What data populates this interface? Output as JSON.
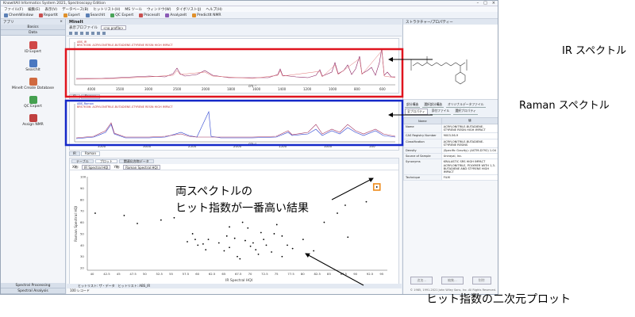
{
  "window": {
    "title": "KnowItAll Informatics System 2021, Spectroscopy Edition",
    "controls": [
      "–",
      "□",
      "×"
    ]
  },
  "menu": [
    "ファイル(F)",
    "編集(E)",
    "表示(V)",
    "データベース(B)",
    "ヒットリスト(H)",
    "MS ツール",
    "ウィンドウ(W)",
    "タイボリスト(J)",
    "ヘルプ(H)"
  ],
  "toolbar": [
    "ChemWindow",
    "ReportIt",
    "Expert",
    "SearchIt",
    "QC Expert",
    "ProcessIt",
    "AnalyzeIt",
    "PredictIt NMR"
  ],
  "sidebar": {
    "title": "アプリ",
    "sections": [
      "Basics",
      "Data"
    ],
    "items": [
      "ID Expert",
      "SearchIt",
      "MineIt Create Database",
      "QC Expert",
      "Assign NMR"
    ],
    "bottom": [
      "Spectral Processing",
      "Spectral Analysis"
    ]
  },
  "main": {
    "title": "MineIt",
    "header_right": "ProfileAssist ▾",
    "profile_label": "表示プロファイル",
    "profile_value": "<no profile>",
    "ir_tabs": [
      "IR",
      "Raman"
    ],
    "raman_tabs": [
      "IR",
      "Raman"
    ]
  },
  "ir_spectrum": {
    "legend_1": "ABS_IR",
    "legend_2": "BRS 9006: ACRYLONITRILE-BUTADIENE-STYRENE RESIN HIGH IMPACT",
    "xticks": [
      "4000",
      "3500",
      "3000",
      "2500",
      "2000",
      "1800",
      "1600",
      "1400",
      "1200",
      "1000",
      "800",
      "600"
    ],
    "xunit": "cm⁻¹"
  },
  "raman_spectrum": {
    "legend_1": "ABS_Raman",
    "legend_2": "BRS 9006: ACRYLONITRILE-BUTADIENE-STYRENE RESIN HIGH IMPACT",
    "xticks": [
      "3500",
      "3000",
      "2500",
      "2000",
      "1500",
      "1000",
      "500"
    ],
    "xunit": "cm⁻¹"
  },
  "lower": {
    "tabs": [
      "テーブル",
      "プロット",
      "関連化合物データ"
    ],
    "x_label_prefix": "X軸:",
    "x_select": "IR Spectral HQI",
    "y_label_prefix": "Y軸:",
    "y_select": "Raman Spectral HQI"
  },
  "chart_data": {
    "type": "scatter",
    "xlabel": "IR Spectral HQI",
    "ylabel": "Raman Spectral HQI",
    "xticks": [
      40,
      42.5,
      45,
      47.5,
      50,
      52.5,
      55,
      57.5,
      60,
      62.5,
      65,
      67.5,
      70,
      72.5,
      75,
      77.5,
      80,
      82.5,
      85,
      87.5,
      90,
      92.5,
      95
    ],
    "yticks": [
      20,
      30,
      40,
      50,
      60,
      70,
      80,
      90,
      100
    ],
    "xlim": [
      39,
      96
    ],
    "ylim": [
      18,
      100
    ],
    "points": [
      [
        40.5,
        68
      ],
      [
        46,
        66
      ],
      [
        48.5,
        59
      ],
      [
        53,
        62
      ],
      [
        55.5,
        64
      ],
      [
        58,
        43
      ],
      [
        59,
        50
      ],
      [
        59.5,
        45
      ],
      [
        60,
        40
      ],
      [
        61,
        41
      ],
      [
        61.5,
        36
      ],
      [
        62,
        45
      ],
      [
        64,
        42
      ],
      [
        65,
        35
      ],
      [
        65.5,
        48
      ],
      [
        66,
        38
      ],
      [
        66,
        56
      ],
      [
        67,
        46
      ],
      [
        67.5,
        30
      ],
      [
        68,
        28
      ],
      [
        68.5,
        60
      ],
      [
        69,
        44
      ],
      [
        69.5,
        55
      ],
      [
        70,
        39
      ],
      [
        70.5,
        42
      ],
      [
        71,
        36
      ],
      [
        71.5,
        32
      ],
      [
        72,
        51
      ],
      [
        72.5,
        45
      ],
      [
        73,
        40
      ],
      [
        74,
        34
      ],
      [
        74.5,
        50
      ],
      [
        75,
        58
      ],
      [
        76,
        48
      ],
      [
        76,
        30
      ],
      [
        77,
        40
      ],
      [
        78,
        37
      ],
      [
        80,
        45
      ],
      [
        82,
        35
      ],
      [
        84,
        60
      ],
      [
        86.5,
        68
      ],
      [
        88,
        75
      ],
      [
        88.5,
        47
      ],
      [
        92,
        78
      ],
      [
        94,
        91
      ]
    ],
    "highlight": [
      94,
      91
    ],
    "highlight_color": "#ee8a1a",
    "point_color": "#000000"
  },
  "status": {
    "tabs": [
      "ヒットリスト: ザ・データ",
      "ヒットリスト: ABS_IR"
    ],
    "count": "100 レコード"
  },
  "right_panel": {
    "title": "ストラクチャー/プロパティー",
    "tabs": [
      "部分構造",
      "選択部分構造",
      "オリジナルデータファイル",
      "全プロパティ",
      "添付ファイル",
      "選択プロパティ"
    ],
    "col_name": "Name",
    "col_value": "値",
    "props": [
      [
        "Name",
        "ACRYLONITRILE-BUTADIENE-STYRENE RESIN HIGH IMPACT"
      ],
      [
        "CAS Registry Number",
        "9003-56-9"
      ],
      [
        "Classification",
        "ACRYLONITRILE-BUTADIENE-STYRENE RESINS"
      ],
      [
        "Density",
        "(Specific Gravity): (ASTM-D792) 1.04"
      ],
      [
        "Source of Sample",
        "Unirayal, Inc."
      ],
      [
        "Synonyms",
        "KRALASTIC SRS HIGH IMPACT ACRYLONITRILE, POLYMER WITH 1,3-BUTADIENE AND STYRENE HIGH IMPACT"
      ],
      [
        "Technique",
        "FILM"
      ]
    ],
    "buttons": [
      "追加...",
      "編集...",
      "削除"
    ],
    "copyright": "© 1985, 1991-2021 John Wiley Sons, Inc. All Rights Reserved."
  },
  "annotations": {
    "ir": "IR スペクトル",
    "raman": "Raman スペクトル",
    "hit_line1": "両スペクトルの",
    "hit_line2": "ヒット指数が一番高い結果",
    "plot": "ヒット指数の二次元プロット"
  },
  "colors": {
    "ir_box": "#e0141e",
    "raman_box": "#1428c8",
    "ir_trace": "#8a2060",
    "raman_trace_1": "#2a40d0",
    "raman_trace_2": "#a03060",
    "highlight": "#ee8a1a"
  }
}
